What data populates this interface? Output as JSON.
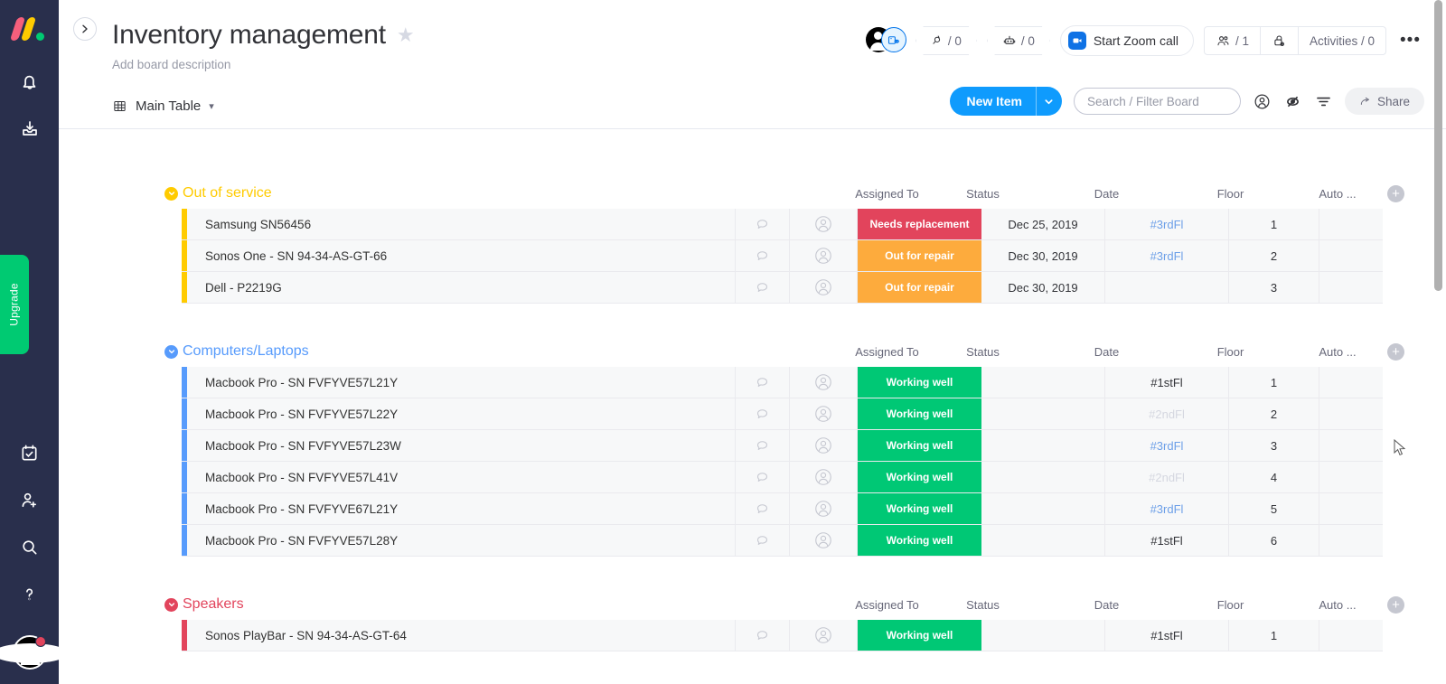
{
  "rail": {
    "logo": "monday-logo",
    "icons": [
      {
        "name": "notifications-bell-icon",
        "label": "Notifications"
      },
      {
        "name": "inbox-icon",
        "label": "Inbox"
      },
      {
        "name": "calendar-check-icon",
        "label": "My Work"
      },
      {
        "name": "invite-member-icon",
        "label": "Invite"
      },
      {
        "name": "search-icon",
        "label": "Search"
      },
      {
        "name": "help-icon",
        "label": "Help"
      }
    ],
    "upgrade_label": "Upgrade",
    "avatar": "user-avatar"
  },
  "header": {
    "title": "Inventory management",
    "star": "★",
    "description": "Add board description",
    "zoom_call_label": "Start Zoom call",
    "search_count": "/ 0",
    "automations_count": "/ 0",
    "members_count": "/ 1",
    "activities_label": "Activities / 0",
    "more_label": "•••"
  },
  "toolbar": {
    "view_label": "Main Table",
    "new_item_label": "New Item",
    "search_placeholder": "Search / Filter Board",
    "search_value": "",
    "share_label": "Share",
    "person_icon": "person-filter-icon",
    "hide_icon": "eye-hidden-icon",
    "filter_icon": "sort-filter-icon"
  },
  "table": {
    "columns": [
      "Assigned To",
      "Status",
      "Date",
      "Floor",
      "Auto ..."
    ],
    "groups": [
      {
        "name": "Out of service",
        "color": "#ffcb00",
        "rows": [
          {
            "name": "Samsung SN56456",
            "status": "Needs replacement",
            "status_color": "#e2445c",
            "date": "Dec 25, 2019",
            "floor": "#3rdFl",
            "floor_style": "floor-3",
            "auto": "1"
          },
          {
            "name": "Sonos One - SN 94-34-AS-GT-66",
            "status": "Out for repair",
            "status_color": "#fdab3d",
            "date": "Dec 30, 2019",
            "floor": "#3rdFl",
            "floor_style": "floor-3",
            "auto": "2"
          },
          {
            "name": "Dell - P2219G",
            "status": "Out for repair",
            "status_color": "#fdab3d",
            "date": "Dec 30, 2019",
            "floor": "",
            "floor_style": "floor-1",
            "auto": "3"
          }
        ]
      },
      {
        "name": "Computers/Laptops",
        "color": "#579bfc",
        "rows": [
          {
            "name": "Macbook Pro - SN FVFYVE57L21Y",
            "status": "Working well",
            "status_color": "#00c875",
            "date": "",
            "floor": "#1stFl",
            "floor_style": "floor-1",
            "auto": "1"
          },
          {
            "name": "Macbook Pro - SN FVFYVE57L22Y",
            "status": "Working well",
            "status_color": "#00c875",
            "date": "",
            "floor": "#2ndFl",
            "floor_style": "floor-2",
            "auto": "2"
          },
          {
            "name": "Macbook Pro - SN FVFYVE57L23W",
            "status": "Working well",
            "status_color": "#00c875",
            "date": "",
            "floor": "#3rdFl",
            "floor_style": "floor-3",
            "auto": "3"
          },
          {
            "name": "Macbook Pro - SN FVFYVE57L41V",
            "status": "Working well",
            "status_color": "#00c875",
            "date": "",
            "floor": "#2ndFl",
            "floor_style": "floor-2",
            "auto": "4"
          },
          {
            "name": "Macbook Pro - SN FVFYVE67L21Y",
            "status": "Working well",
            "status_color": "#00c875",
            "date": "",
            "floor": "#3rdFl",
            "floor_style": "floor-3",
            "auto": "5"
          },
          {
            "name": "Macbook Pro - SN FVFYVE57L28Y",
            "status": "Working well",
            "status_color": "#00c875",
            "date": "",
            "floor": "#1stFl",
            "floor_style": "floor-1",
            "auto": "6"
          }
        ]
      },
      {
        "name": "Speakers",
        "color": "#e2445c",
        "rows": [
          {
            "name": "Sonos PlayBar - SN 94-34-AS-GT-64",
            "status": "Working well",
            "status_color": "#00c875",
            "date": "",
            "floor": "#1stFl",
            "floor_style": "floor-1",
            "auto": "1"
          }
        ]
      }
    ]
  }
}
